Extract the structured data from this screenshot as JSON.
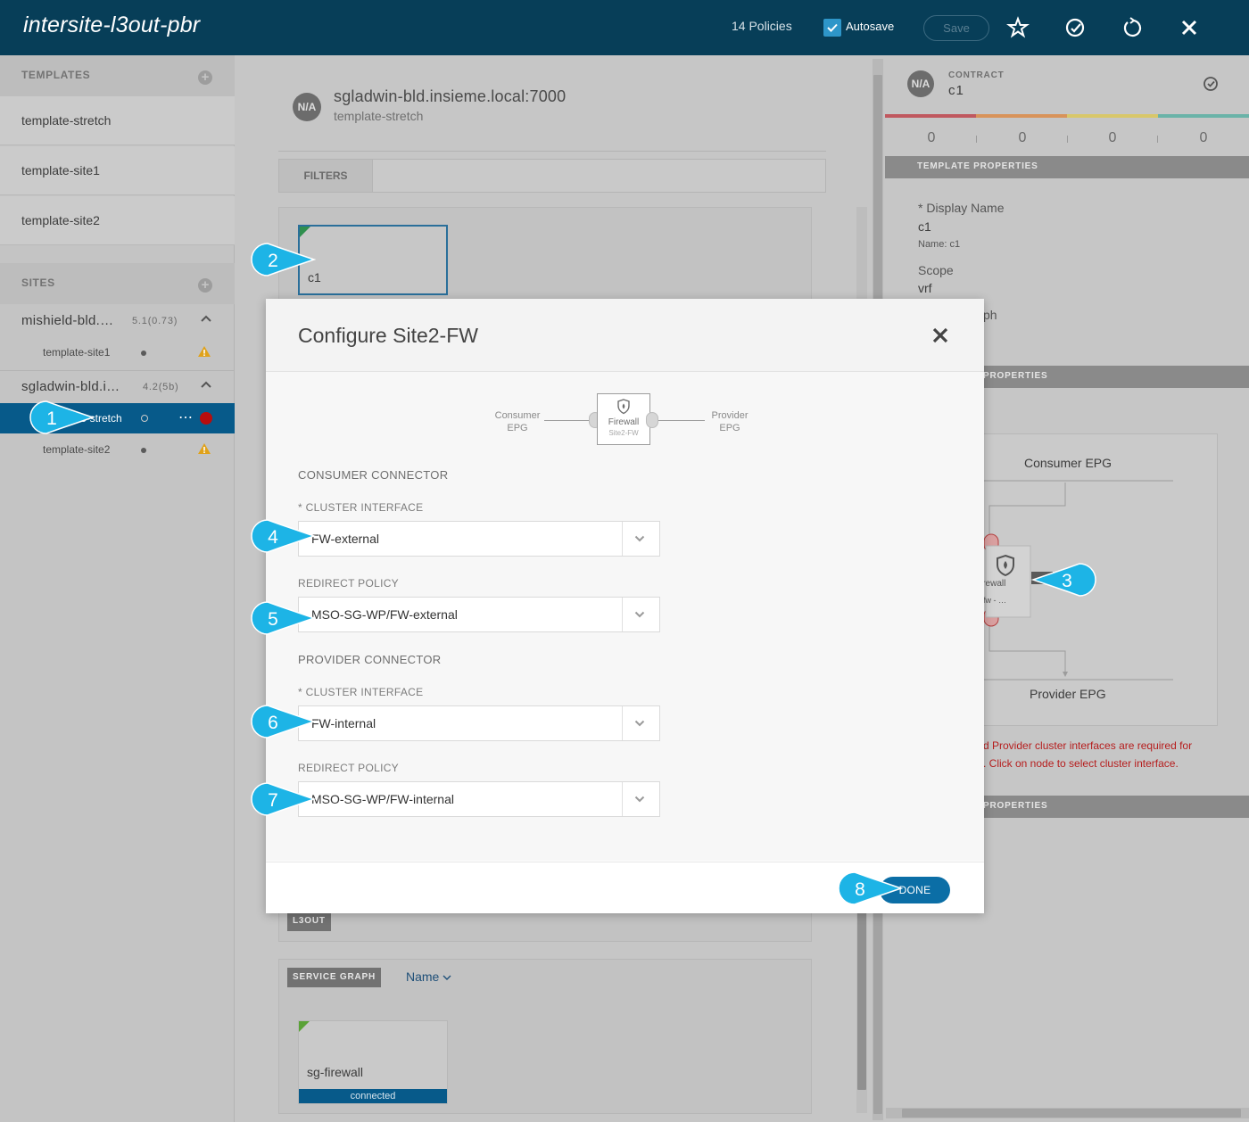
{
  "topbar": {
    "title": "intersite-l3out-pbr",
    "policies": "14 Policies",
    "autosave_label": "Autosave",
    "autosave_checked": true,
    "save_label": "Save"
  },
  "sidebar": {
    "templates_header": "TEMPLATES",
    "templates": [
      "template-stretch",
      "template-site1",
      "template-site2"
    ],
    "sites_header": "SITES",
    "sites": [
      {
        "name": "mishield-bld.…",
        "version": "5.1(0.73)",
        "templates": [
          {
            "name": "template-site1",
            "status": "warning"
          }
        ]
      },
      {
        "name": "sgladwin-bld.i…",
        "version": "4.2(5b)",
        "templates": [
          {
            "name": "e-stretch",
            "status": "error",
            "active": true
          },
          {
            "name": "template-site2",
            "status": "warning"
          }
        ]
      }
    ],
    "more": "⋯"
  },
  "main": {
    "badge": "N/A",
    "site_host": "sgladwin-bld.insieme.local:7000",
    "template": "template-stretch",
    "filters": "FILTERS",
    "contract_card": "c1",
    "l3out_tag": "L3OUT",
    "service_graph_tag": "SERVICE GRAPH",
    "name_sort": "Name",
    "sg_card": "sg-firewall",
    "sg_status": "connected"
  },
  "right_panel": {
    "badge": "N/A",
    "type_label": "CONTRACT",
    "name": "c1",
    "counts": [
      "0",
      "0",
      "0",
      "0"
    ],
    "status_colors": [
      "#c0585f",
      "#d8935a",
      "#d8c76a",
      "#6ab3a8"
    ],
    "template_properties": "TEMPLATE PROPERTIES",
    "display_name_label": "* Display Name",
    "display_name": "c1",
    "name_note": "Name: c1",
    "scope_label": "Scope",
    "scope": "vrf",
    "partial_label": "ph",
    "properties_header": "PROPERTIES",
    "consumer_epg": "Consumer EPG",
    "provider_epg": "Provider EPG",
    "node_label": "irewall",
    "node_sub": "-fw - …",
    "error_line1": "d Provider cluster interfaces are required for",
    "error_line2": ". Click on node to select cluster interface.",
    "properties_header2": "PROPERTIES"
  },
  "modal": {
    "title": "Configure Site2-FW",
    "diagram": {
      "consumer_line1": "Consumer",
      "consumer_line2": "EPG",
      "provider_line1": "Provider",
      "provider_line2": "EPG",
      "node_label": "Firewall",
      "node_sub": "Site2-FW"
    },
    "consumer_connector": "CONSUMER CONNECTOR",
    "provider_connector": "PROVIDER CONNECTOR",
    "cluster_interface_label": "* CLUSTER INTERFACE",
    "redirect_policy_label": "REDIRECT POLICY",
    "consumer_cluster_interface": "FW-external",
    "consumer_redirect_policy": "MSO-SG-WP/FW-external",
    "provider_cluster_interface": "FW-internal",
    "provider_redirect_policy": "MSO-SG-WP/FW-internal",
    "done_label": "DONE"
  },
  "callouts": [
    "1",
    "2",
    "3",
    "4",
    "5",
    "6",
    "7",
    "8"
  ],
  "callout_color": "#1db4e6"
}
